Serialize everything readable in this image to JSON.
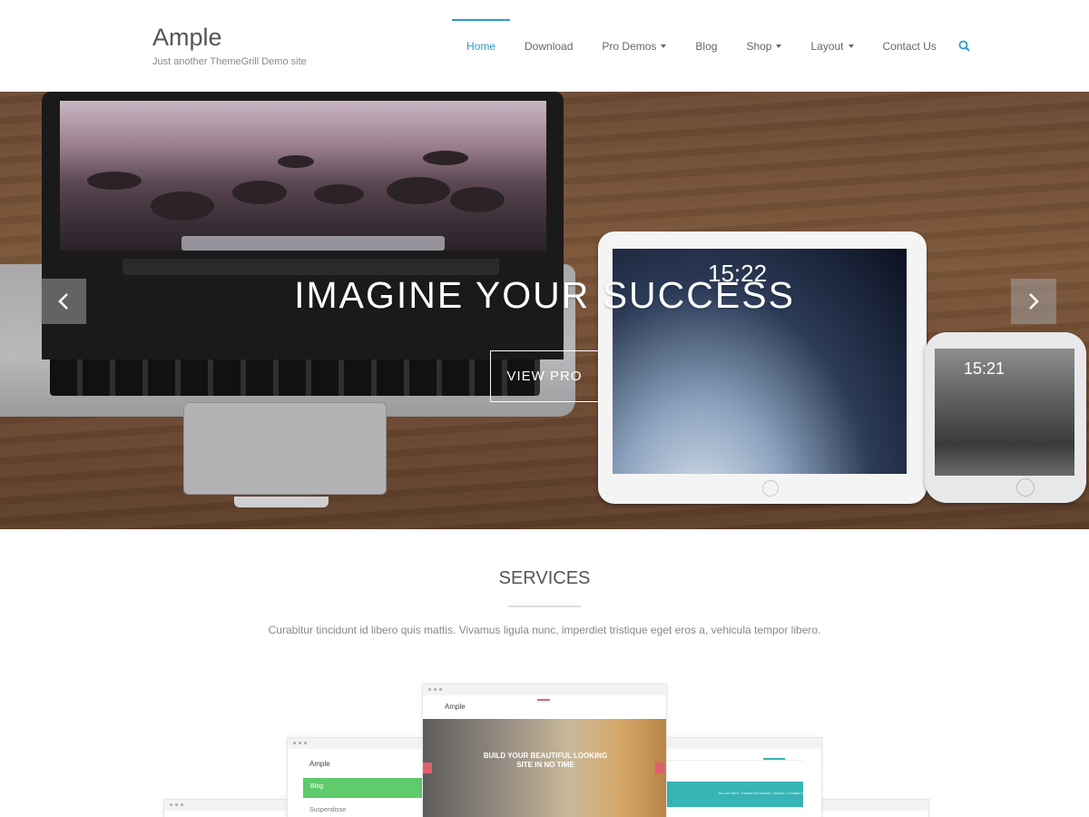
{
  "header": {
    "site_title": "Ample",
    "site_description": "Just another ThemeGrill Demo site",
    "nav": [
      {
        "label": "Home",
        "active": true,
        "dropdown": false
      },
      {
        "label": "Download",
        "active": false,
        "dropdown": false
      },
      {
        "label": "Pro Demos",
        "active": false,
        "dropdown": true
      },
      {
        "label": "Blog",
        "active": false,
        "dropdown": false
      },
      {
        "label": "Shop",
        "active": false,
        "dropdown": true
      },
      {
        "label": "Layout",
        "active": false,
        "dropdown": true
      },
      {
        "label": "Contact Us",
        "active": false,
        "dropdown": false
      }
    ],
    "accent_color": "#289dcc"
  },
  "hero": {
    "title": "IMAGINE YOUR SUCCESS",
    "button_label": "VIEW PRO",
    "tablet_time": "15:22",
    "phone_time": "15:21"
  },
  "services": {
    "title": "SERVICES",
    "description": "Curabitur tincidunt id libero quis mattis. Vivamus ligula nunc, imperdiet tristique eget eros a, vehicula tempor libero."
  },
  "previews": {
    "center_logo": "Ample",
    "center_headline_1": "BUILD YOUR BEAUTIFUL LOOKING",
    "center_headline_2": "SITE IN NO TIME",
    "left_logo": "Ample",
    "left_banner": "Blog",
    "left_post": "Suspendisse",
    "right_crumb": "You are here: ThemeGrill Demos › Ample › Contact Us"
  }
}
